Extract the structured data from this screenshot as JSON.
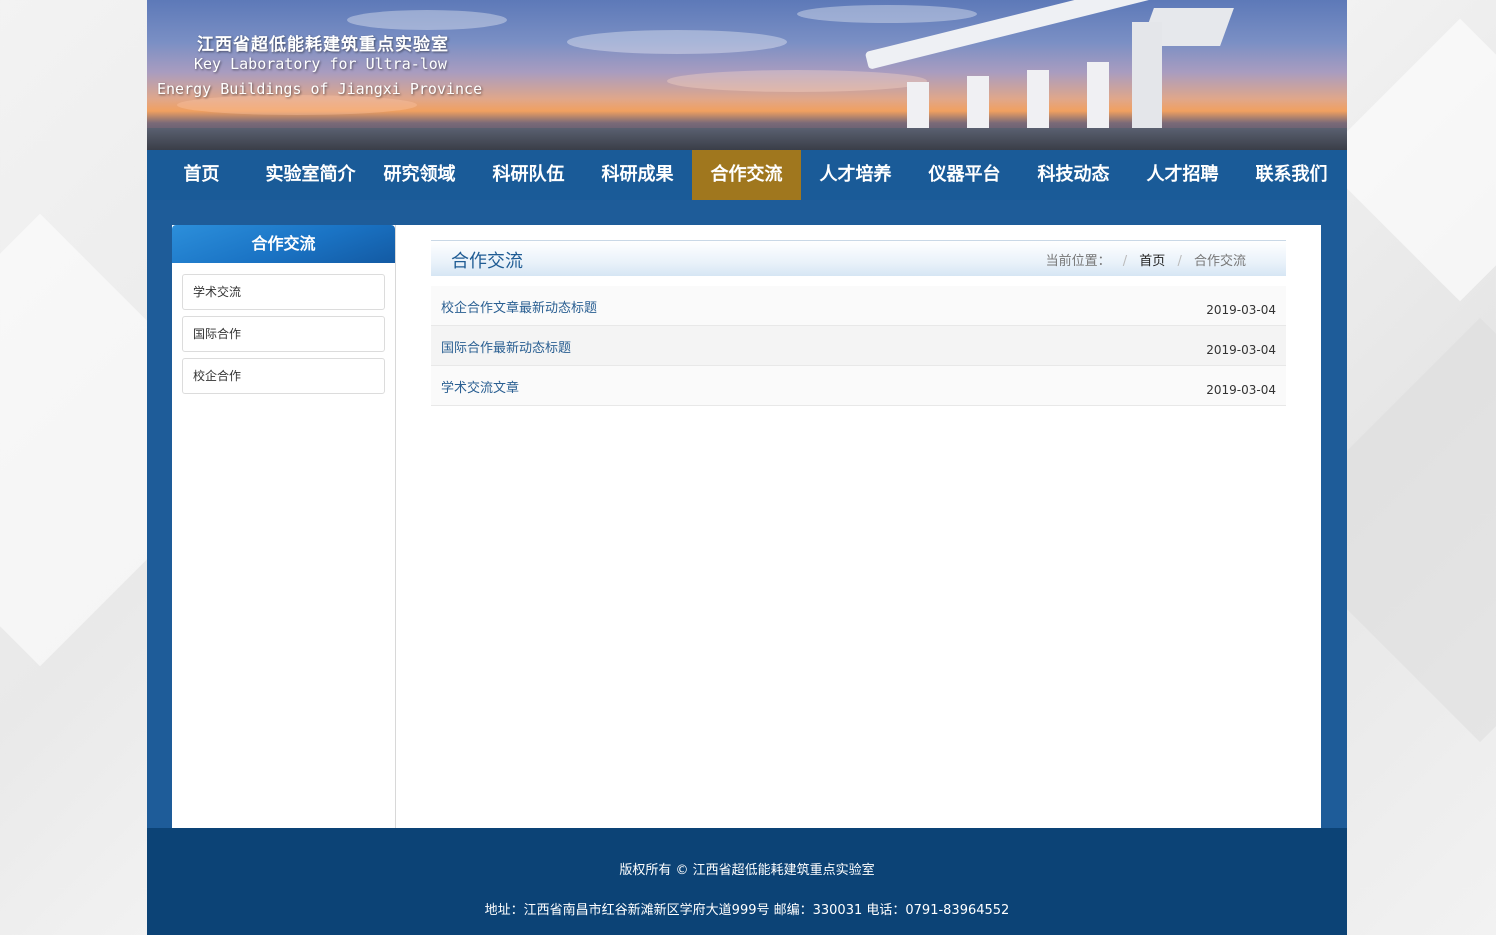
{
  "banner": {
    "title_cn": "江西省超低能耗建筑重点实验室",
    "title_en_line1": "Key Laboratory for Ultra-low",
    "title_en_line2": "Energy Buildings of Jiangxi Province"
  },
  "nav": {
    "items": [
      "首页",
      "实验室简介",
      "研究领域",
      "科研队伍",
      "科研成果",
      "合作交流",
      "人才培养",
      "仪器平台",
      "科技动态",
      "人才招聘",
      "联系我们"
    ],
    "active": "合作交流"
  },
  "sidebar": {
    "title": "合作交流",
    "items": [
      "学术交流",
      "国际合作",
      "校企合作"
    ]
  },
  "main": {
    "title": "合作交流",
    "breadcrumb": {
      "label": "当前位置：",
      "sep": "/",
      "home": "首页",
      "current": "合作交流"
    },
    "articles": [
      {
        "title": "校企合作文章最新动态标题",
        "date": "2019-03-04"
      },
      {
        "title": "国际合作最新动态标题",
        "date": "2019-03-04"
      },
      {
        "title": "学术交流文章",
        "date": "2019-03-04"
      }
    ]
  },
  "footer": {
    "copyright": "版权所有 © 江西省超低能耗建筑重点实验室",
    "address": "地址：江西省南昌市红谷新滩新区学府大道999号 邮编：330031 电话：0791-83964552"
  },
  "colors": {
    "nav_bg": "#1a5b98",
    "nav_active": "#a0771e",
    "footer_bg": "#0c4376",
    "link": "#2a5f92"
  }
}
